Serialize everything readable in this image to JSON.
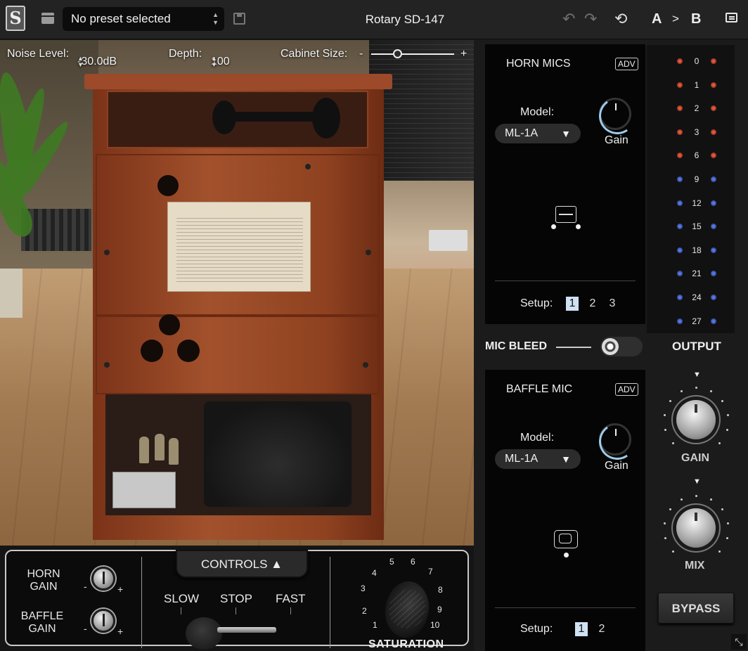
{
  "header": {
    "preset": "No preset selected",
    "title": "Rotary SD-147",
    "a_label": "A",
    "ab_sep": ">",
    "b_label": "B",
    "icons": [
      "logo-icon",
      "menu-icon",
      "save-icon",
      "undo-icon",
      "redo-icon",
      "loop-icon",
      "chat-icon"
    ]
  },
  "stage": {
    "noise_label": "Noise Level:",
    "noise_value": "-30.0dB",
    "depth_label": "Depth:",
    "depth_value": "100",
    "cabinet_label": "Cabinet Size:",
    "cabinet_minus": "-",
    "cabinet_plus": "+"
  },
  "bottom": {
    "horn_gain": "HORN\nGAIN",
    "baffle_gain": "BAFFLE\nGAIN",
    "minus": "-",
    "plus": "+",
    "controls": "CONTROLS ▲",
    "slow": "SLOW",
    "stop": "STOP",
    "fast": "FAST",
    "saturation": "SATURATION",
    "saturation_marks": [
      "1",
      "2",
      "3",
      "4",
      "5",
      "6",
      "7",
      "8",
      "9",
      "10"
    ]
  },
  "horn_mics": {
    "title": "HORN MICS",
    "adv": "ADV",
    "model_label": "Model:",
    "model_value": "ML-1A",
    "gain_label": "Gain",
    "setup_label": "Setup:",
    "setups": [
      "1",
      "2",
      "3"
    ],
    "active_setup": "1"
  },
  "mic_bleed": {
    "label": "MIC BLEED"
  },
  "baffle_mic": {
    "title": "BAFFLE MIC",
    "adv": "ADV",
    "model_label": "Model:",
    "model_value": "ML-1A",
    "gain_label": "Gain",
    "setup_label": "Setup:",
    "setups": [
      "1",
      "2"
    ],
    "active_setup": "1"
  },
  "meter": {
    "labels": [
      "0",
      "1",
      "2",
      "3",
      "6",
      "9",
      "12",
      "15",
      "18",
      "21",
      "24",
      "27"
    ],
    "colors": {
      "red": "#c0402a",
      "blue": "#3d5bd6"
    }
  },
  "output": {
    "title": "OUTPUT",
    "gain_label": "GAIN",
    "mix_label": "MIX",
    "bypass": "BYPASS"
  }
}
